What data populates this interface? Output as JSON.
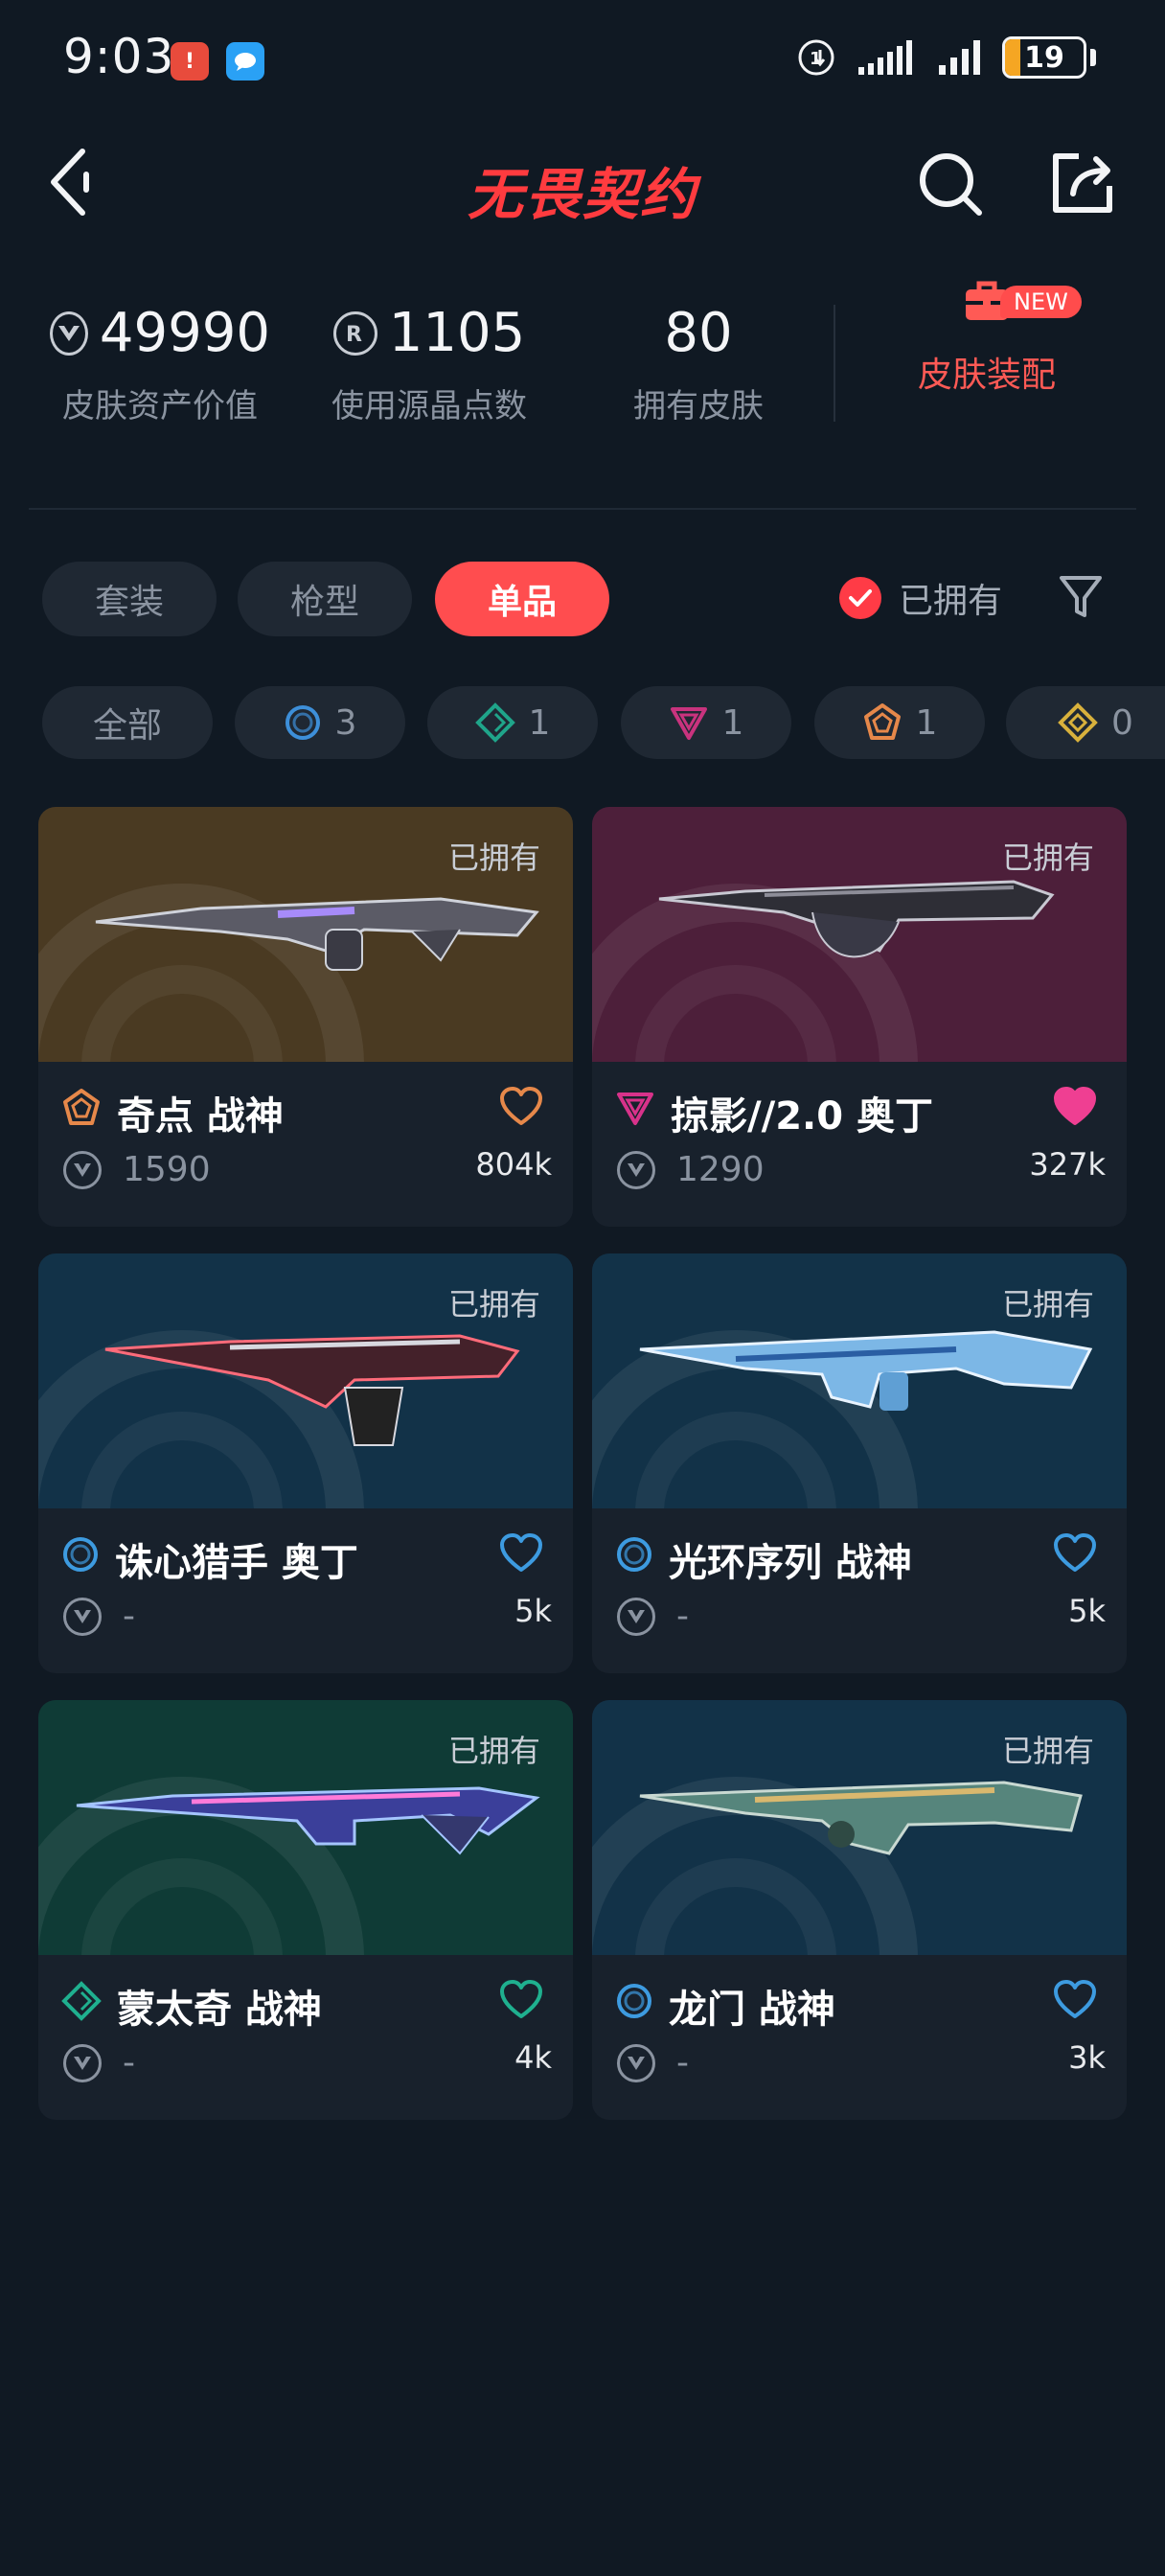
{
  "status_bar": {
    "time": "9:03",
    "battery": "19",
    "battery_level": 0.19
  },
  "header": {
    "title": "无畏契约",
    "back_icon": "chevron-left-icon",
    "search_icon": "search-icon",
    "share_icon": "share-icon"
  },
  "stats": [
    {
      "value": "49990",
      "label": "皮肤资产价值",
      "icon": "valorant-point-icon"
    },
    {
      "value": "1105",
      "label": "使用源晶点数",
      "icon": "radianite-icon"
    },
    {
      "value": "80",
      "label": "拥有皮肤"
    }
  ],
  "equip": {
    "label": "皮肤装配",
    "badge": "NEW",
    "icon": "briefcase-icon"
  },
  "tabs": [
    {
      "label": "套装",
      "active": false
    },
    {
      "label": "枪型",
      "active": false
    },
    {
      "label": "单品",
      "active": true
    }
  ],
  "owned_filter": {
    "label": "已拥有",
    "checked": true
  },
  "rarity_chips": [
    {
      "label": "全部"
    },
    {
      "count": "3",
      "icon": "select-tier-icon",
      "color": "#3d8fd9"
    },
    {
      "count": "1",
      "icon": "deluxe-tier-icon",
      "color": "#1fa58a"
    },
    {
      "count": "1",
      "icon": "premium-tier-icon",
      "color": "#c9337e"
    },
    {
      "count": "1",
      "icon": "exclusive-tier-icon",
      "color": "#e6884a"
    },
    {
      "count": "0",
      "icon": "ultra-tier-icon",
      "color": "#d8b13c"
    }
  ],
  "cards": [
    {
      "owned": "已拥有",
      "name": "奇点 战神",
      "price": "1590",
      "likes": "804k",
      "tier_icon": "exclusive-tier-icon",
      "tier_color": "#e6884a",
      "liked": false,
      "heart_color": "#e6884a",
      "art_bg": "#4a3a22"
    },
    {
      "owned": "已拥有",
      "name": "掠影//2.0 奥丁",
      "price": "1290",
      "likes": "327k",
      "tier_icon": "premium-tier-icon",
      "tier_color": "#d8328a",
      "liked": true,
      "heart_color": "#ef3f92",
      "art_bg": "#4d1f3a"
    },
    {
      "owned": "已拥有",
      "name": "诛心猎手 奥丁",
      "price": "-",
      "likes": "5k",
      "tier_icon": "select-tier-icon",
      "tier_color": "#3d9be0",
      "liked": false,
      "heart_color": "#3d9be0",
      "art_bg": "#123248"
    },
    {
      "owned": "已拥有",
      "name": "光环序列 战神",
      "price": "-",
      "likes": "5k",
      "tier_icon": "select-tier-icon",
      "tier_color": "#3d9be0",
      "liked": false,
      "heart_color": "#3d9be0",
      "art_bg": "#123248"
    },
    {
      "owned": "已拥有",
      "name": "蒙太奇 战神",
      "price": "-",
      "likes": "4k",
      "tier_icon": "deluxe-tier-icon",
      "tier_color": "#1fb08f",
      "liked": false,
      "heart_color": "#1fb08f",
      "art_bg": "#0f3b36"
    },
    {
      "owned": "已拥有",
      "name": "龙门 战神",
      "price": "-",
      "likes": "3k",
      "tier_icon": "select-tier-icon",
      "tier_color": "#3d9be0",
      "liked": false,
      "heart_color": "#3d9be0",
      "art_bg": "#123248"
    }
  ]
}
